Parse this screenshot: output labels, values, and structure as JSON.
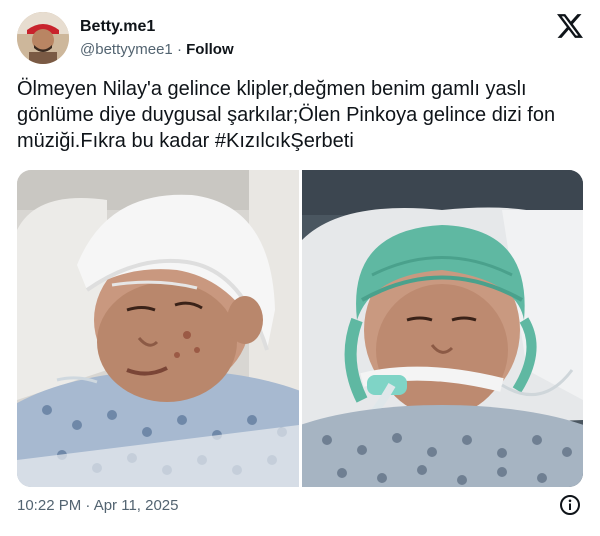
{
  "author": {
    "display_name": "Betty.me1",
    "handle": "@bettyymee1",
    "separator": "·",
    "follow_label": "Follow"
  },
  "tweet": {
    "text": "Ölmeyen Nilay'a gelince klipler,değmen benim gamlı yaslı gönlüme diye duygusal şarkılar;Ölen Pinkoya gelince dizi fon müziği.Fıkra bu kadar #KızılcıkŞerbeti",
    "timestamp": "10:22 PM · Apr 11, 2025"
  },
  "media": [
    {
      "icon": "photo-hospital-patient-bandage"
    },
    {
      "icon": "photo-hospital-patient-surgical-cap"
    }
  ],
  "icons": {
    "brand": "x-logo-icon",
    "info": "info-icon"
  },
  "colors": {
    "text_primary": "#0f1419",
    "text_secondary": "#536471"
  }
}
